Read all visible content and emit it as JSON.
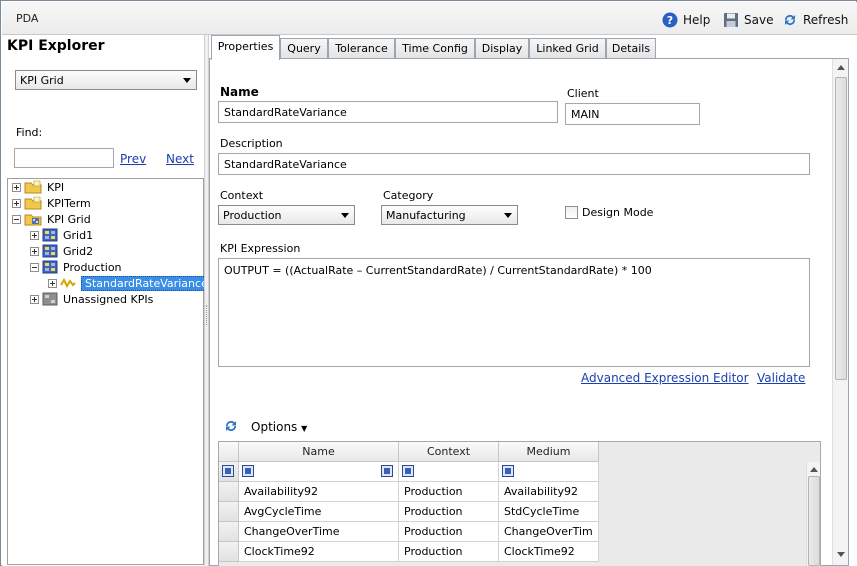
{
  "app": {
    "title": "PDA"
  },
  "toolbar": {
    "help_label": "Help",
    "save_label": "Save",
    "refresh_label": "Refresh"
  },
  "explorer": {
    "title": "KPI Explorer",
    "view_select": "KPI Grid",
    "find_label": "Find:",
    "find_value": "",
    "prev_label": "Prev",
    "next_label": "Next",
    "tree": {
      "kpi": "KPI",
      "kpiterm": "KPITerm",
      "kpigrid": "KPI Grid",
      "grid1": "Grid1",
      "grid2": "Grid2",
      "production": "Production",
      "selected": "StandardRateVariance",
      "unassigned": "Unassigned KPIs"
    }
  },
  "tabs": [
    "Properties",
    "Query",
    "Tolerance",
    "Time Config",
    "Display",
    "Linked Grid",
    "Details"
  ],
  "properties": {
    "name_label": "Name",
    "name_value": "StandardRateVariance",
    "client_label": "Client",
    "client_value": "MAIN",
    "description_label": "Description",
    "description_value": "StandardRateVariance",
    "context_label": "Context",
    "context_value": "Production",
    "category_label": "Category",
    "category_value": "Manufacturing",
    "design_mode_label": "Design Mode",
    "design_mode_checked": false,
    "expression_label": "KPI Expression",
    "expression_value": "OUTPUT = ((ActualRate – CurrentStandardRate) / CurrentStandardRate) * 100",
    "advanced_editor_label": "Advanced Expression Editor",
    "validate_label": "Validate",
    "options_label": "Options"
  },
  "grid": {
    "columns": [
      "Name",
      "Context",
      "Medium"
    ],
    "rows": [
      [
        "Availability92",
        "Production",
        "Availability92"
      ],
      [
        "AvgCycleTime",
        "Production",
        "StdCycleTime"
      ],
      [
        "ChangeOverTime",
        "Production",
        "ChangeOverTim"
      ],
      [
        "ClockTime92",
        "Production",
        "ClockTime92"
      ]
    ]
  },
  "colors": {
    "accent": "#3a8ee6",
    "link": "#1a3fb0",
    "border": "#9aa6b2"
  }
}
